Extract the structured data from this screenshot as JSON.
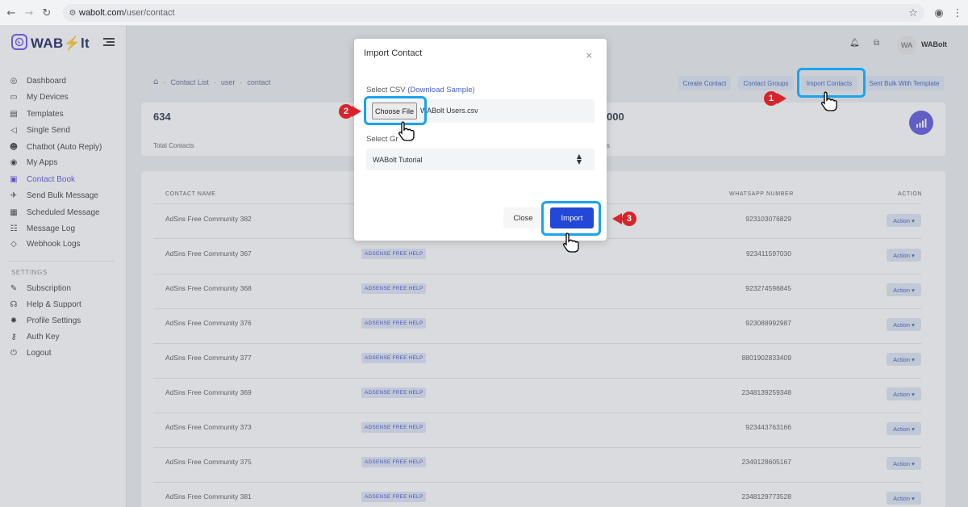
{
  "browser": {
    "url_host": "wabolt.com",
    "url_path": "/user/contact"
  },
  "sidebar": {
    "logo_prefix": "WAB",
    "logo_bolt": "⚡",
    "logo_suffix": "lt",
    "items": [
      {
        "label": "Dashboard",
        "icon": "dashboard-icon"
      },
      {
        "label": "My Devices",
        "icon": "device-icon"
      },
      {
        "label": "Templates",
        "icon": "template-icon"
      },
      {
        "label": "Single Send",
        "icon": "send-icon"
      },
      {
        "label": "Chatbot (Auto Reply)",
        "icon": "robot-icon"
      },
      {
        "label": "My Apps",
        "icon": "apps-icon"
      },
      {
        "label": "Contact Book",
        "icon": "contact-book-icon",
        "active": true
      },
      {
        "label": "Send Bulk Message",
        "icon": "bulk-send-icon"
      },
      {
        "label": "Scheduled Message",
        "icon": "calendar-icon"
      },
      {
        "label": "Message Log",
        "icon": "log-icon"
      },
      {
        "label": "Webhook Logs",
        "icon": "webhook-icon"
      }
    ],
    "settings_heading": "SETTINGS",
    "settings_items": [
      {
        "label": "Subscription",
        "icon": "subscription-icon"
      },
      {
        "label": "Help & Support",
        "icon": "support-icon"
      },
      {
        "label": "Profile Settings",
        "icon": "settings-icon"
      },
      {
        "label": "Auth Key",
        "icon": "key-icon"
      },
      {
        "label": "Logout",
        "icon": "logout-icon"
      }
    ]
  },
  "header": {
    "avatar_initials": "WA",
    "user_name": "WABolt"
  },
  "breadcrumb": [
    "Contact List",
    "user",
    "contact"
  ],
  "actions": {
    "create_contact": "Create Contact",
    "contact_groups": "Contact Groups",
    "import_contacts": "Import Contacts",
    "sent_bulk": "Sent Bulk With Template"
  },
  "stats": {
    "total_contacts_value": "634",
    "total_contacts_label": "Total Contacts",
    "second_value_partial": "000",
    "second_label_partial": "s"
  },
  "table": {
    "headers": {
      "name": "CONTACT NAME",
      "number": "WHATSAPP NUMBER",
      "action": "ACTION"
    },
    "action_label": "Action ▾",
    "rows": [
      {
        "name": "AdSns Free Community 382",
        "tag": "",
        "number": "923103076829"
      },
      {
        "name": "AdSns Free Community 367",
        "tag": "ADSENSE FREE HELP",
        "number": "923411597030"
      },
      {
        "name": "AdSns Free Community 368",
        "tag": "ADSENSE FREE HELP",
        "number": "923274596845"
      },
      {
        "name": "AdSns Free Community 376",
        "tag": "ADSENSE FREE HELP",
        "number": "923088992987"
      },
      {
        "name": "AdSns Free Community 377",
        "tag": "ADSENSE FREE HELP",
        "number": "8801902833409"
      },
      {
        "name": "AdSns Free Community 369",
        "tag": "ADSENSE FREE HELP",
        "number": "2348139259348"
      },
      {
        "name": "AdSns Free Community 373",
        "tag": "ADSENSE FREE HELP",
        "number": "923443763166"
      },
      {
        "name": "AdSns Free Community 375",
        "tag": "ADSENSE FREE HELP",
        "number": "2349128605167"
      },
      {
        "name": "AdSns Free Community 381",
        "tag": "ADSENSE FREE HELP",
        "number": "2348129773528"
      }
    ]
  },
  "modal": {
    "title": "Import Contact",
    "close_icon": "×",
    "csv_label": "Select CSV",
    "download_link": "(Download Sample)",
    "choose_file": "Choose File",
    "file_name": "WABolt Users.csv",
    "group_label": "Select Gr",
    "group_value": "WABolt Tutorial",
    "close_button": "Close",
    "import_button": "Import"
  },
  "annotations": {
    "step1": "1",
    "step2": "2",
    "step3": "3",
    "highlight_color": "#1aa3ef",
    "marker_color": "#d8232a"
  }
}
